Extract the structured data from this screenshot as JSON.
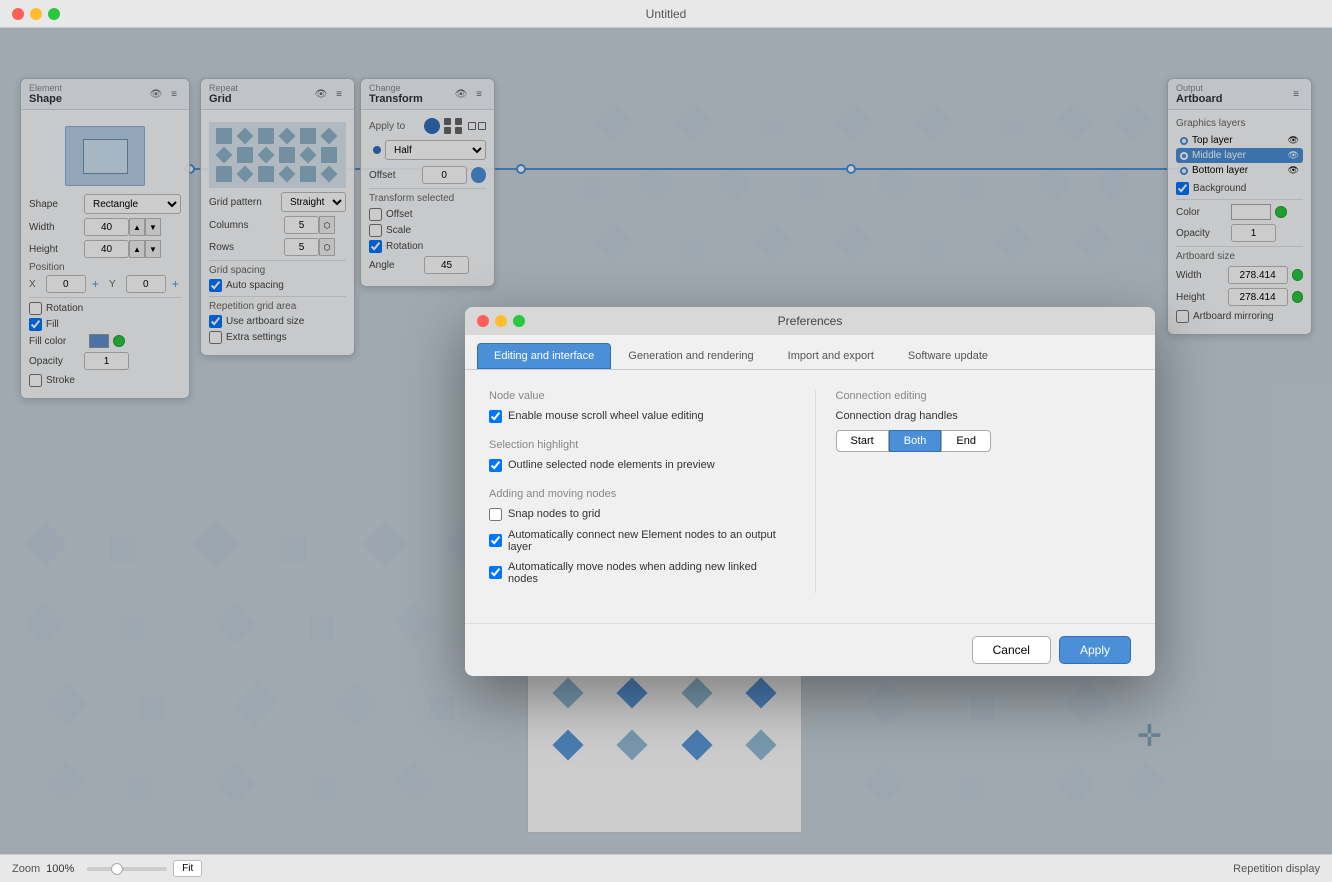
{
  "app": {
    "title": "Untitled"
  },
  "titlebar": {
    "close": "×",
    "min": "−",
    "max": "+"
  },
  "shape_panel": {
    "subtitle": "Element",
    "title": "Shape",
    "shape_label": "Shape",
    "shape_value": "Rectangle",
    "width_label": "Width",
    "width_value": "40",
    "height_label": "Height",
    "height_value": "40",
    "position_label": "Position",
    "x_label": "X",
    "x_value": "0",
    "y_label": "Y",
    "y_value": "0",
    "rotation_label": "Rotation",
    "rotation_checked": false,
    "fill_label": "Fill",
    "fill_checked": true,
    "fill_color_label": "Fill color",
    "opacity_label": "Opacity",
    "opacity_value": "1",
    "stroke_label": "Stroke",
    "stroke_checked": false
  },
  "grid_panel": {
    "subtitle": "Repeat",
    "title": "Grid",
    "pattern_label": "Grid pattern",
    "pattern_value": "Straight",
    "columns_label": "Columns",
    "columns_value": "5",
    "rows_label": "Rows",
    "rows_value": "5",
    "spacing_label": "Grid spacing",
    "auto_spacing_label": "Auto spacing",
    "auto_spacing_checked": true,
    "area_label": "Repetition grid area",
    "use_artboard_label": "Use artboard size",
    "use_artboard_checked": true,
    "extra_settings_label": "Extra settings",
    "extra_settings_checked": false
  },
  "transform_panel": {
    "subtitle": "Change",
    "title": "Transform",
    "apply_to_label": "Apply to",
    "offset_label": "Offset",
    "offset_value": "0",
    "transform_selected_label": "Transform selected",
    "offset_checked": false,
    "scale_checked": false,
    "rotation_checked": true,
    "angle_label": "Angle",
    "angle_value": "45"
  },
  "artboard_panel": {
    "subtitle": "Output",
    "title": "Artboard",
    "graphics_layers_label": "Graphics layers",
    "top_layer_label": "Top layer",
    "middle_layer_label": "Middle layer",
    "bottom_layer_label": "Bottom layer",
    "background_label": "Background",
    "background_checked": true,
    "color_label": "Color",
    "opacity_label": "Opacity",
    "opacity_value": "1",
    "artboard_size_label": "Artboard size",
    "width_label": "Width",
    "width_value": "278.414",
    "height_label": "Height",
    "height_value": "278.414",
    "mirroring_label": "Artboard mirroring",
    "mirroring_checked": false
  },
  "preferences_modal": {
    "title": "Preferences",
    "tabs": [
      {
        "id": "editing",
        "label": "Editing and interface",
        "active": true
      },
      {
        "id": "generation",
        "label": "Generation and rendering",
        "active": false
      },
      {
        "id": "import",
        "label": "Import and export",
        "active": false
      },
      {
        "id": "software",
        "label": "Software update",
        "active": false
      }
    ],
    "node_value_section": "Node value",
    "enable_scroll_label": "Enable mouse scroll wheel value editing",
    "enable_scroll_checked": true,
    "connection_editing_section": "Connection editing",
    "connection_drag_label": "Connection drag handles",
    "connection_start": "Start",
    "connection_both": "Both",
    "connection_end": "End",
    "selection_highlight_section": "Selection highlight",
    "outline_selected_label": "Outline selected node elements in preview",
    "outline_selected_checked": true,
    "adding_moving_section": "Adding and moving nodes",
    "snap_nodes_label": "Snap nodes to grid",
    "snap_nodes_checked": false,
    "auto_connect_label": "Automatically connect new Element nodes to an output layer",
    "auto_connect_checked": true,
    "auto_move_label": "Automatically move nodes when adding new linked nodes",
    "auto_move_checked": true,
    "cancel_label": "Cancel",
    "apply_label": "Apply"
  },
  "status_bar": {
    "zoom_label": "Zoom",
    "zoom_value": "100%",
    "fit_label": "Fit",
    "repetition_display_label": "Repetition display"
  }
}
